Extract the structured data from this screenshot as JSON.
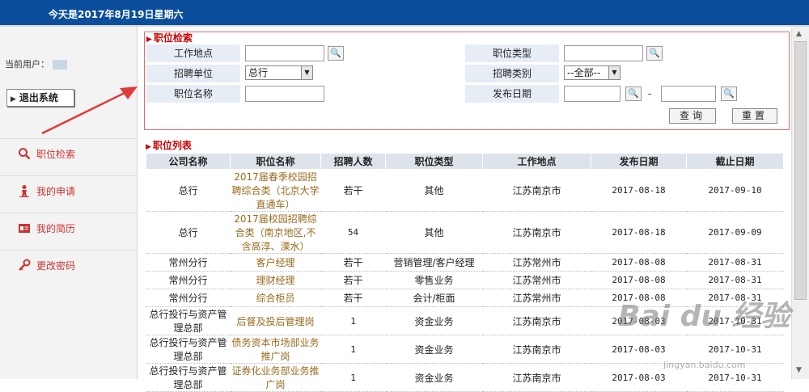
{
  "header": {
    "date_text": "今天是2017年8月19日星期六"
  },
  "sidebar": {
    "current_user_label": "当前用户：",
    "logout_label": "退出系统",
    "items": [
      {
        "label": "职位检索",
        "icon": "search-icon"
      },
      {
        "label": "我的申请",
        "icon": "person-icon"
      },
      {
        "label": "我的简历",
        "icon": "resume-icon"
      },
      {
        "label": "更改密码",
        "icon": "key-icon"
      }
    ]
  },
  "search": {
    "title": "职位检索",
    "work_location_label": "工作地点",
    "job_type_label": "职位类型",
    "recruit_unit_label": "招聘单位",
    "recruit_unit_value": "总行",
    "recruit_category_label": "招聘类别",
    "recruit_category_value": "--全部--",
    "job_name_label": "职位名称",
    "publish_date_label": "发布日期",
    "date_separator": "-",
    "query_button": "查询",
    "reset_button": "重置"
  },
  "list": {
    "title": "职位列表",
    "columns": [
      "公司名称",
      "职位名称",
      "招聘人数",
      "职位类型",
      "工作地点",
      "发布日期",
      "截止日期"
    ],
    "rows": [
      [
        "总行",
        "2017届春季校园招聘综合类（北京大学直通车）",
        "若干",
        "其他",
        "江苏南京市",
        "2017-08-18",
        "2017-09-10"
      ],
      [
        "总行",
        "2017届校园招聘综合类（南京地区,不含高淳、溧水）",
        "54",
        "其他",
        "江苏南京市",
        "2017-08-18",
        "2017-09-09"
      ],
      [
        "常州分行",
        "客户经理",
        "若干",
        "营销管理/客户经理",
        "江苏常州市",
        "2017-08-08",
        "2017-08-31"
      ],
      [
        "常州分行",
        "理财经理",
        "若干",
        "零售业务",
        "江苏常州市",
        "2017-08-08",
        "2017-08-31"
      ],
      [
        "常州分行",
        "综合柜员",
        "若干",
        "会计/柜面",
        "江苏常州市",
        "2017-08-08",
        "2017-08-31"
      ],
      [
        "总行投行与资产管理总部",
        "后督及投后管理岗",
        "1",
        "资金业务",
        "江苏南京市",
        "2017-08-03",
        "2017-10-31"
      ],
      [
        "总行投行与资产管理总部",
        "债务资本市场部业务推广岗",
        "1",
        "资金业务",
        "江苏南京市",
        "2017-08-03",
        "2017-10-31"
      ],
      [
        "总行投行与资产管理总部",
        "证券化业务部业务推广岗",
        "1",
        "资金业务",
        "江苏南京市",
        "2017-08-03",
        "2017-10-31"
      ]
    ]
  },
  "watermark": {
    "logo_text": "Bai du 经验",
    "url_text": "jingyan.baidu.com"
  },
  "colors": {
    "header_bg": "#0b4e9b",
    "accent_red": "#c00",
    "link_brown": "#9a6a1e",
    "label_bg": "#e7edf5",
    "arrow_red": "#e03a3a"
  }
}
